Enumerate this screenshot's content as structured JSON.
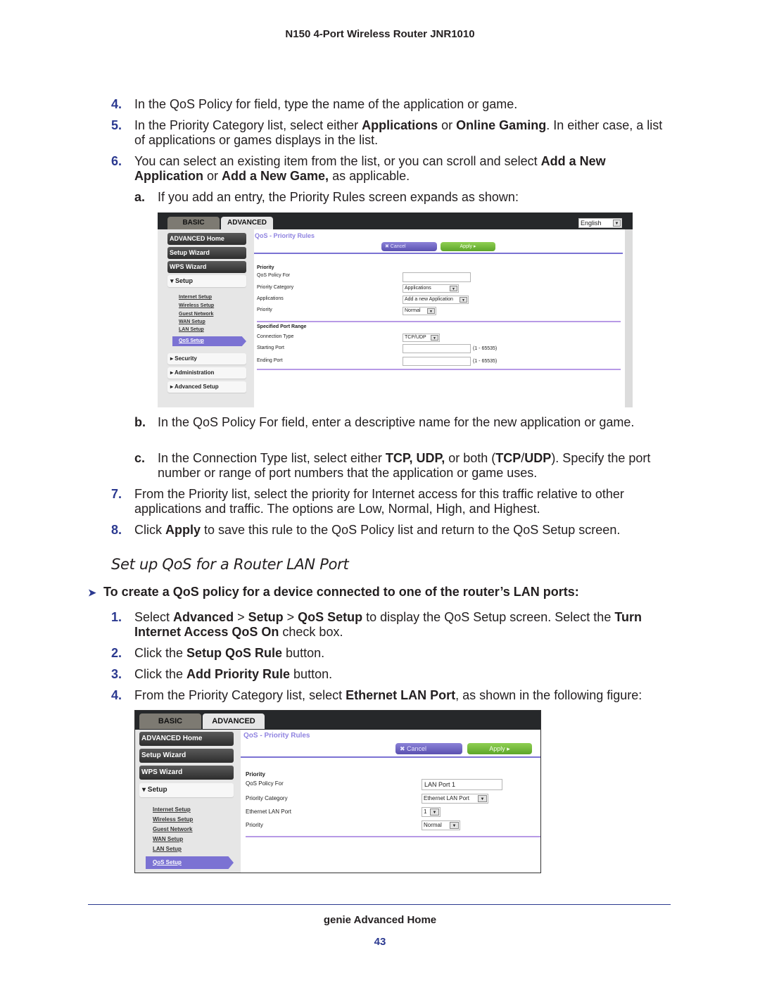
{
  "header": {
    "title": "N150 4-Port Wireless Router JNR1010"
  },
  "steps_a": [
    {
      "num": "4.",
      "parts": [
        {
          "t": "In the QoS Policy for field, type the name of the application or game."
        }
      ]
    },
    {
      "num": "5.",
      "parts": [
        {
          "t": "In the Priority Category list, select either "
        },
        {
          "t": "Applications",
          "b": true
        },
        {
          "t": " or "
        },
        {
          "t": "Online Gaming",
          "b": true
        },
        {
          "t": ". In either case, a list of applications or games displays in the list."
        }
      ]
    },
    {
      "num": "6.",
      "parts": [
        {
          "t": "You can select an existing item from the list, or you can scroll and select "
        },
        {
          "t": "Add a New Application",
          "b": true
        },
        {
          "t": " or "
        },
        {
          "t": "Add a New Game,",
          "b": true
        },
        {
          "t": " as applicable."
        }
      ]
    }
  ],
  "substeps_a": [
    {
      "num": "a.",
      "parts": [
        {
          "t": "If you add an entry, the Priority Rules screen expands as shown:"
        }
      ]
    }
  ],
  "substeps_b": [
    {
      "num": "b.",
      "parts": [
        {
          "t": "In the QoS Policy For field, enter a descriptive name for the new application or game."
        }
      ]
    },
    {
      "num": "c.",
      "parts": [
        {
          "t": "In the Connection Type list, select either "
        },
        {
          "t": "TCP, UDP,",
          "b": true
        },
        {
          "t": " or both ("
        },
        {
          "t": "TCP",
          "b": true
        },
        {
          "t": "/"
        },
        {
          "t": "UDP",
          "b": true
        },
        {
          "t": "). Specify the port number or range of port numbers that the application or game uses."
        }
      ]
    }
  ],
  "steps_b": [
    {
      "num": "7.",
      "parts": [
        {
          "t": "From the Priority list, select the priority for Internet access for this traffic relative to other applications and traffic. The options are Low, Normal, High, and Highest."
        }
      ]
    },
    {
      "num": "8.",
      "parts": [
        {
          "t": "Click "
        },
        {
          "t": "Apply",
          "b": true
        },
        {
          "t": " to save this rule to the QoS Policy list and return to the QoS Setup screen."
        }
      ]
    }
  ],
  "section": {
    "title": "Set up QoS for a Router LAN Port",
    "procedure_heading": "To create a QoS policy for a device connected to one of the router’s LAN ports:",
    "arrow_icon": "➤"
  },
  "steps_c": [
    {
      "num": "1.",
      "parts": [
        {
          "t": "Select "
        },
        {
          "t": "Advanced",
          "b": true
        },
        {
          "t": " > "
        },
        {
          "t": "Setup",
          "b": true
        },
        {
          "t": " > "
        },
        {
          "t": "QoS Setup",
          "b": true
        },
        {
          "t": " to display the QoS Setup screen. Select the "
        },
        {
          "t": "Turn Internet Access QoS On",
          "b": true
        },
        {
          "t": " check box."
        }
      ]
    },
    {
      "num": "2.",
      "parts": [
        {
          "t": "Click the "
        },
        {
          "t": "Setup QoS Rule",
          "b": true
        },
        {
          "t": " button."
        }
      ]
    },
    {
      "num": "3.",
      "parts": [
        {
          "t": "Click the "
        },
        {
          "t": "Add Priority Rule",
          "b": true
        },
        {
          "t": " button."
        }
      ]
    },
    {
      "num": "4.",
      "parts": [
        {
          "t": "From the Priority Category list, select "
        },
        {
          "t": "Ethernet LAN Port",
          "b": true
        },
        {
          "t": ", as shown in the following figure:"
        }
      ]
    }
  ],
  "router1": {
    "tabs": {
      "basic": "BASIC",
      "advanced": "ADVANCED"
    },
    "language": "English",
    "nav": {
      "home": "ADVANCED Home",
      "wizard": "Setup Wizard",
      "wps": "WPS Wizard",
      "setup": "▾ Setup",
      "security": "▸ Security",
      "admin": "▸ Administration",
      "advsetup": "▸ Advanced Setup"
    },
    "sublinks": [
      "Internet Setup",
      "Wireless Setup",
      "Guest Network",
      "WAN Setup",
      "LAN Setup",
      "QoS Setup"
    ],
    "page_title": "QoS - Priority Rules",
    "cancel": "✖   Cancel",
    "apply": "Apply   ▸",
    "priority_heading": "Priority",
    "labels": {
      "policy_for": "QoS Policy For",
      "category": "Priority Category",
      "applications": "Applications",
      "priority": "Priority"
    },
    "values": {
      "policy_for": "",
      "category": "Applications",
      "applications": "Add a new Application",
      "priority": "Normal"
    },
    "port_heading": "Specified Port Range",
    "port_labels": {
      "conn_type": "Connection Type",
      "start": "Starting Port",
      "end": "Ending Port"
    },
    "port_values": {
      "conn_type": "TCP/UDP",
      "start": "",
      "end": ""
    },
    "range_hint": "(1 - 65535)"
  },
  "router2": {
    "tabs": {
      "basic": "BASIC",
      "advanced": "ADVANCED"
    },
    "nav": {
      "home": "ADVANCED Home",
      "wizard": "Setup Wizard",
      "wps": "WPS Wizard",
      "setup": "▾ Setup"
    },
    "sublinks": [
      "Internet Setup",
      "Wireless Setup",
      "Guest Network",
      "WAN Setup",
      "LAN Setup",
      "QoS Setup"
    ],
    "page_title": "QoS - Priority Rules",
    "cancel": "✖   Cancel",
    "apply": "Apply   ▸",
    "priority_heading": "Priority",
    "labels": {
      "policy_for": "QoS Policy For",
      "category": "Priority Category",
      "lan_port": "Ethernet LAN Port",
      "priority": "Priority"
    },
    "values": {
      "policy_for": "LAN Port 1",
      "category": "Ethernet LAN Port",
      "lan_port": "1",
      "priority": "Normal"
    }
  },
  "footer": {
    "title": "genie Advanced Home",
    "page": "43"
  },
  "icons": {
    "dropdown": "▼"
  }
}
